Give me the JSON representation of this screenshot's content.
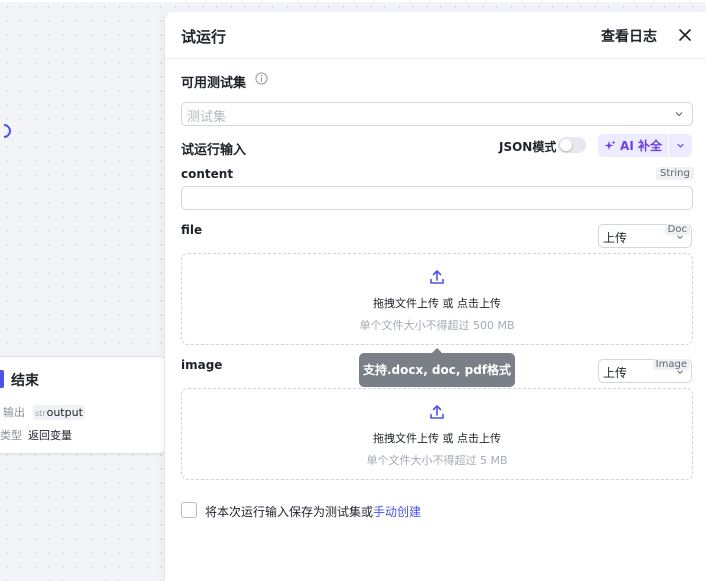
{
  "canvas": {
    "end_node": {
      "title": "结束",
      "output_label": "输出",
      "output_type": "str",
      "output_name": "output",
      "return_type_label": "类型",
      "return_type_value": "返回变量"
    }
  },
  "panel": {
    "title": "试运行",
    "view_log": "查看日志",
    "test_set_label": "可用测试集",
    "test_set_placeholder": "测试集",
    "input_label": "试运行输入",
    "json_mode_label": "JSON模式",
    "ai_complete_label": "AI 补全",
    "fields": {
      "content": {
        "name": "content",
        "type": "String"
      },
      "file": {
        "name": "file",
        "mode": "上传",
        "type": "Doc",
        "drop_text": "拖拽文件上传",
        "drop_or": "或",
        "drop_click": "点击上传",
        "limit_text": "单个文件大小不得超过 500 MB"
      },
      "image": {
        "name": "image",
        "mode": "上传",
        "type": "Image",
        "drop_text": "拖拽文件上传",
        "drop_or": "或",
        "drop_click": "点击上传",
        "limit_text": "单个文件大小不得超过 5 MB"
      }
    },
    "tooltip": "支持.docx, doc, pdf格式",
    "save_text": "将本次运行输入保存为测试集或",
    "save_link": "手动创建"
  },
  "colors": {
    "accent": "#4d53e8",
    "ai_purple": "#6b3ee6"
  }
}
